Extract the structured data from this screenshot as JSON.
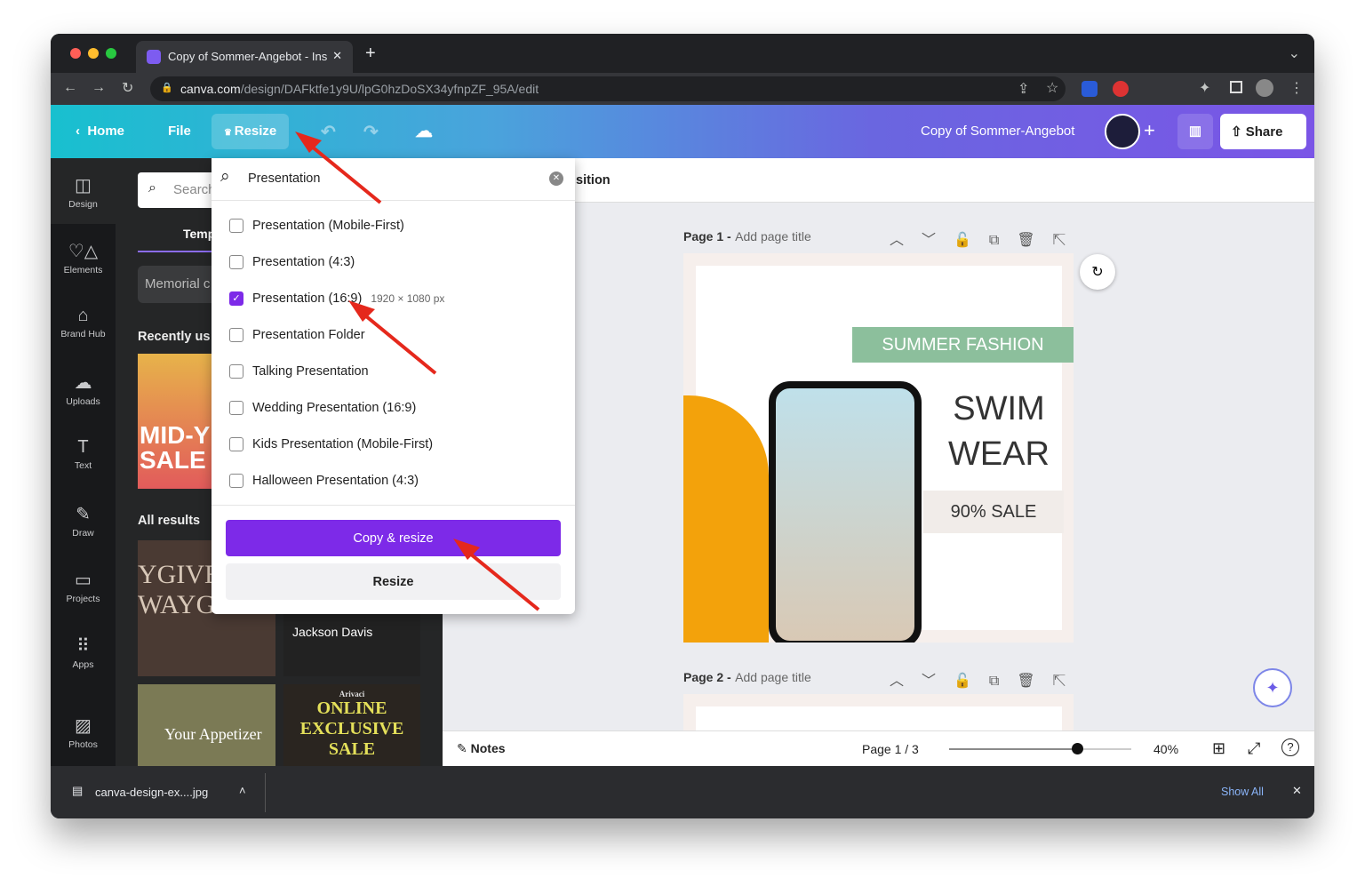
{
  "browser": {
    "tab_title": "Copy of Sommer-Angebot - Ins",
    "url_host": "canva.com",
    "url_path": "/design/DAFktfe1y9U/lpG0hzDoSX34yfnpZF_95A/edit"
  },
  "header": {
    "home": "Home",
    "file": "File",
    "resize": "Resize",
    "doc_title": "Copy of Sommer-Angebot",
    "share": "Share",
    "gradient": [
      "#18c0cf",
      "#7a55e6"
    ]
  },
  "sidebar": {
    "items": [
      {
        "label": "Design",
        "icon": "layout-icon"
      },
      {
        "label": "Elements",
        "icon": "shapes-icon"
      },
      {
        "label": "Brand Hub",
        "icon": "brand-icon"
      },
      {
        "label": "Uploads",
        "icon": "cloud-upload-icon"
      },
      {
        "label": "Text",
        "icon": "text-icon"
      },
      {
        "label": "Draw",
        "icon": "draw-icon"
      },
      {
        "label": "Projects",
        "icon": "folder-icon"
      },
      {
        "label": "Apps",
        "icon": "apps-icon"
      },
      {
        "label": "Photos",
        "icon": "image-icon"
      }
    ]
  },
  "panel": {
    "search_placeholder": "Search",
    "tab": "Temp",
    "chip": "Memorial c",
    "recent": "Recently us",
    "all_results": "All results",
    "thumbs": [
      "MID-YEA SALE",
      "YGIVE WAYGIVEA",
      "Jackson Davis",
      "Your Appetizer",
      "Arivaci",
      "ONLINE EXCLUSIVE SALE"
    ]
  },
  "resize_menu": {
    "search_value": "Presentation",
    "options": [
      {
        "label": "Presentation (Mobile-First)",
        "checked": false
      },
      {
        "label": "Presentation (4:3)",
        "checked": false
      },
      {
        "label": "Presentation (16:9)",
        "checked": true,
        "size": "1920 × 1080 px"
      },
      {
        "label": "Presentation Folder",
        "checked": false
      },
      {
        "label": "Talking Presentation",
        "checked": false
      },
      {
        "label": "Wedding Presentation (16:9)",
        "checked": false
      },
      {
        "label": "Kids Presentation (Mobile-First)",
        "checked": false
      },
      {
        "label": "Halloween Presentation (4:3)",
        "checked": false
      }
    ],
    "copy_resize": "Copy & resize",
    "resize": "Resize",
    "accent": "#7d2ae8"
  },
  "toolbar": {
    "position_partial": "sition"
  },
  "pages": [
    {
      "label": "Page 1 -",
      "title_placeholder": "Add page title"
    },
    {
      "label": "Page 2 -",
      "title_placeholder": "Add page title"
    }
  ],
  "design": {
    "banner": "SUMMER FASHION",
    "swim": "SWIM",
    "wear": "WEAR",
    "sale": "90% SALE"
  },
  "footer": {
    "notes": "Notes",
    "page_indicator": "Page 1 / 3",
    "zoom": "40%",
    "zoom_value": 40
  },
  "downloads": {
    "file": "canva-design-ex....jpg",
    "show_all": "Show All"
  }
}
